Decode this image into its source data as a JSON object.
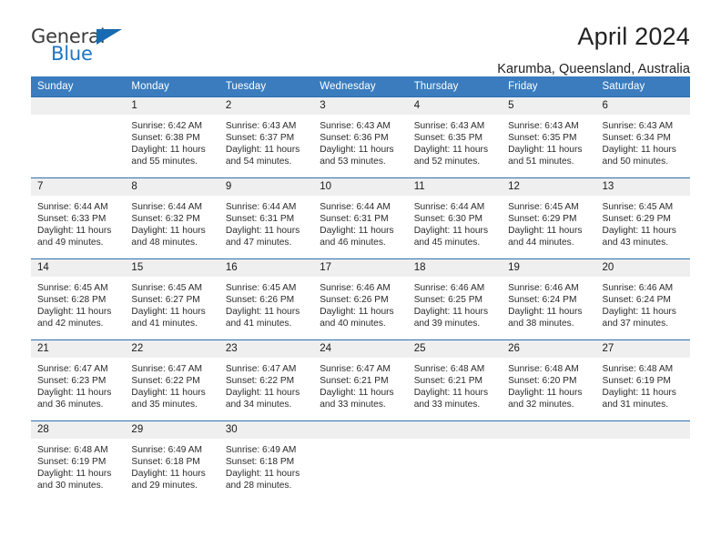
{
  "brand": {
    "name_part1": "General",
    "name_part2": "Blue",
    "logo_icon": "triangle-logo-icon"
  },
  "header": {
    "title": "April 2024",
    "location": "Karumba, Queensland, Australia"
  },
  "colors": {
    "header_blue": "#3a7cbe",
    "row_border_blue": "#2f6fb0",
    "daynum_background": "#efefef",
    "brand_blue": "#1f77c4"
  },
  "calendar": {
    "weekday_headers": [
      "Sunday",
      "Monday",
      "Tuesday",
      "Wednesday",
      "Thursday",
      "Friday",
      "Saturday"
    ],
    "weeks": [
      [
        {
          "day": "",
          "empty": true
        },
        {
          "day": "1",
          "sunrise": "Sunrise: 6:42 AM",
          "sunset": "Sunset: 6:38 PM",
          "daylight_line1": "Daylight: 11 hours",
          "daylight_line2": "and 55 minutes."
        },
        {
          "day": "2",
          "sunrise": "Sunrise: 6:43 AM",
          "sunset": "Sunset: 6:37 PM",
          "daylight_line1": "Daylight: 11 hours",
          "daylight_line2": "and 54 minutes."
        },
        {
          "day": "3",
          "sunrise": "Sunrise: 6:43 AM",
          "sunset": "Sunset: 6:36 PM",
          "daylight_line1": "Daylight: 11 hours",
          "daylight_line2": "and 53 minutes."
        },
        {
          "day": "4",
          "sunrise": "Sunrise: 6:43 AM",
          "sunset": "Sunset: 6:35 PM",
          "daylight_line1": "Daylight: 11 hours",
          "daylight_line2": "and 52 minutes."
        },
        {
          "day": "5",
          "sunrise": "Sunrise: 6:43 AM",
          "sunset": "Sunset: 6:35 PM",
          "daylight_line1": "Daylight: 11 hours",
          "daylight_line2": "and 51 minutes."
        },
        {
          "day": "6",
          "sunrise": "Sunrise: 6:43 AM",
          "sunset": "Sunset: 6:34 PM",
          "daylight_line1": "Daylight: 11 hours",
          "daylight_line2": "and 50 minutes."
        }
      ],
      [
        {
          "day": "7",
          "sunrise": "Sunrise: 6:44 AM",
          "sunset": "Sunset: 6:33 PM",
          "daylight_line1": "Daylight: 11 hours",
          "daylight_line2": "and 49 minutes."
        },
        {
          "day": "8",
          "sunrise": "Sunrise: 6:44 AM",
          "sunset": "Sunset: 6:32 PM",
          "daylight_line1": "Daylight: 11 hours",
          "daylight_line2": "and 48 minutes."
        },
        {
          "day": "9",
          "sunrise": "Sunrise: 6:44 AM",
          "sunset": "Sunset: 6:31 PM",
          "daylight_line1": "Daylight: 11 hours",
          "daylight_line2": "and 47 minutes."
        },
        {
          "day": "10",
          "sunrise": "Sunrise: 6:44 AM",
          "sunset": "Sunset: 6:31 PM",
          "daylight_line1": "Daylight: 11 hours",
          "daylight_line2": "and 46 minutes."
        },
        {
          "day": "11",
          "sunrise": "Sunrise: 6:44 AM",
          "sunset": "Sunset: 6:30 PM",
          "daylight_line1": "Daylight: 11 hours",
          "daylight_line2": "and 45 minutes."
        },
        {
          "day": "12",
          "sunrise": "Sunrise: 6:45 AM",
          "sunset": "Sunset: 6:29 PM",
          "daylight_line1": "Daylight: 11 hours",
          "daylight_line2": "and 44 minutes."
        },
        {
          "day": "13",
          "sunrise": "Sunrise: 6:45 AM",
          "sunset": "Sunset: 6:29 PM",
          "daylight_line1": "Daylight: 11 hours",
          "daylight_line2": "and 43 minutes."
        }
      ],
      [
        {
          "day": "14",
          "sunrise": "Sunrise: 6:45 AM",
          "sunset": "Sunset: 6:28 PM",
          "daylight_line1": "Daylight: 11 hours",
          "daylight_line2": "and 42 minutes."
        },
        {
          "day": "15",
          "sunrise": "Sunrise: 6:45 AM",
          "sunset": "Sunset: 6:27 PM",
          "daylight_line1": "Daylight: 11 hours",
          "daylight_line2": "and 41 minutes."
        },
        {
          "day": "16",
          "sunrise": "Sunrise: 6:45 AM",
          "sunset": "Sunset: 6:26 PM",
          "daylight_line1": "Daylight: 11 hours",
          "daylight_line2": "and 41 minutes."
        },
        {
          "day": "17",
          "sunrise": "Sunrise: 6:46 AM",
          "sunset": "Sunset: 6:26 PM",
          "daylight_line1": "Daylight: 11 hours",
          "daylight_line2": "and 40 minutes."
        },
        {
          "day": "18",
          "sunrise": "Sunrise: 6:46 AM",
          "sunset": "Sunset: 6:25 PM",
          "daylight_line1": "Daylight: 11 hours",
          "daylight_line2": "and 39 minutes."
        },
        {
          "day": "19",
          "sunrise": "Sunrise: 6:46 AM",
          "sunset": "Sunset: 6:24 PM",
          "daylight_line1": "Daylight: 11 hours",
          "daylight_line2": "and 38 minutes."
        },
        {
          "day": "20",
          "sunrise": "Sunrise: 6:46 AM",
          "sunset": "Sunset: 6:24 PM",
          "daylight_line1": "Daylight: 11 hours",
          "daylight_line2": "and 37 minutes."
        }
      ],
      [
        {
          "day": "21",
          "sunrise": "Sunrise: 6:47 AM",
          "sunset": "Sunset: 6:23 PM",
          "daylight_line1": "Daylight: 11 hours",
          "daylight_line2": "and 36 minutes."
        },
        {
          "day": "22",
          "sunrise": "Sunrise: 6:47 AM",
          "sunset": "Sunset: 6:22 PM",
          "daylight_line1": "Daylight: 11 hours",
          "daylight_line2": "and 35 minutes."
        },
        {
          "day": "23",
          "sunrise": "Sunrise: 6:47 AM",
          "sunset": "Sunset: 6:22 PM",
          "daylight_line1": "Daylight: 11 hours",
          "daylight_line2": "and 34 minutes."
        },
        {
          "day": "24",
          "sunrise": "Sunrise: 6:47 AM",
          "sunset": "Sunset: 6:21 PM",
          "daylight_line1": "Daylight: 11 hours",
          "daylight_line2": "and 33 minutes."
        },
        {
          "day": "25",
          "sunrise": "Sunrise: 6:48 AM",
          "sunset": "Sunset: 6:21 PM",
          "daylight_line1": "Daylight: 11 hours",
          "daylight_line2": "and 33 minutes."
        },
        {
          "day": "26",
          "sunrise": "Sunrise: 6:48 AM",
          "sunset": "Sunset: 6:20 PM",
          "daylight_line1": "Daylight: 11 hours",
          "daylight_line2": "and 32 minutes."
        },
        {
          "day": "27",
          "sunrise": "Sunrise: 6:48 AM",
          "sunset": "Sunset: 6:19 PM",
          "daylight_line1": "Daylight: 11 hours",
          "daylight_line2": "and 31 minutes."
        }
      ],
      [
        {
          "day": "28",
          "sunrise": "Sunrise: 6:48 AM",
          "sunset": "Sunset: 6:19 PM",
          "daylight_line1": "Daylight: 11 hours",
          "daylight_line2": "and 30 minutes."
        },
        {
          "day": "29",
          "sunrise": "Sunrise: 6:49 AM",
          "sunset": "Sunset: 6:18 PM",
          "daylight_line1": "Daylight: 11 hours",
          "daylight_line2": "and 29 minutes."
        },
        {
          "day": "30",
          "sunrise": "Sunrise: 6:49 AM",
          "sunset": "Sunset: 6:18 PM",
          "daylight_line1": "Daylight: 11 hours",
          "daylight_line2": "and 28 minutes."
        },
        {
          "day": "",
          "empty": true
        },
        {
          "day": "",
          "empty": true
        },
        {
          "day": "",
          "empty": true
        },
        {
          "day": "",
          "empty": true
        }
      ]
    ]
  }
}
